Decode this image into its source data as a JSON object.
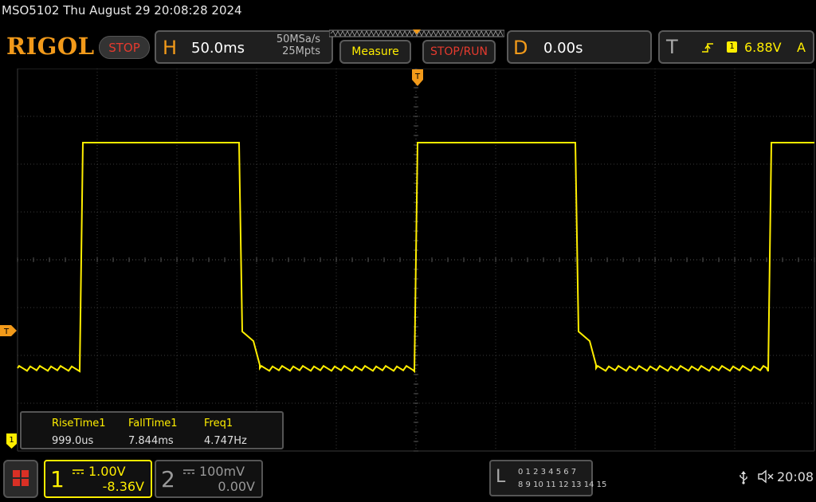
{
  "title_line": "MSO5102  Thu August 29 20:08:28 2024",
  "brand": "RIGOL",
  "run_status": "STOP",
  "horizontal": {
    "letter": "H",
    "timebase": "50.0ms",
    "sample_rate": "50MSa/s",
    "memory_depth": "25Mpts"
  },
  "buttons": {
    "measure": "Measure",
    "stop_run": "STOP/RUN"
  },
  "delay": {
    "letter": "D",
    "value": "0.00s"
  },
  "trigger": {
    "letter": "T",
    "source": "1",
    "level": "6.88V",
    "mode": "A",
    "edge_icon": "rising-edge-icon"
  },
  "markers": {
    "trigger_position": "T",
    "trigger_level": "T",
    "ch1_ground": "1"
  },
  "measurements": [
    {
      "name": "RiseTime1",
      "value": "999.0us"
    },
    {
      "name": "FallTime1",
      "value": "7.844ms"
    },
    {
      "name": "Freq1",
      "value": "4.747Hz"
    }
  ],
  "channels": [
    {
      "number": "1",
      "scale": "1.00V",
      "offset": "-8.36V",
      "color": "#ffee00"
    },
    {
      "number": "2",
      "scale": "100mV",
      "offset": "0.00V",
      "color": "#999999"
    }
  ],
  "logic": {
    "letter": "L",
    "row1": "0 1 2 3  4 5 6 7",
    "row2": "8 9 10 11 12 13 14 15"
  },
  "status_bar": {
    "time": "20:08"
  },
  "icons": [
    "usb-icon",
    "speaker-muted-icon",
    "menu-grid-icon",
    "trigger-edge-icon"
  ],
  "colors": {
    "trace_ch1": "#ffee00",
    "accent_orange": "#f29a1a",
    "stop_red": "#e53a2e",
    "grid": "#3a3a3a"
  }
}
